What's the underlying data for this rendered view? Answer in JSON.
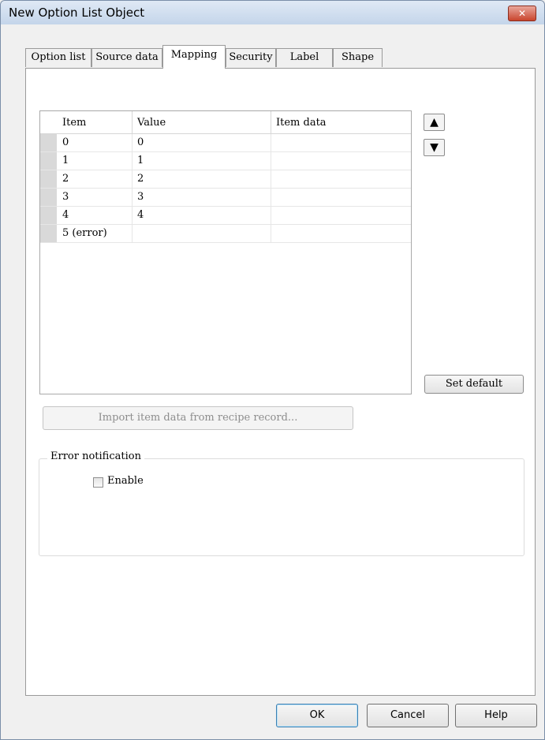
{
  "window": {
    "title": "New Option List Object",
    "close_glyph": "✕"
  },
  "tabs": [
    "Option list",
    "Source data",
    "Mapping",
    "Security",
    "Label",
    "Shape"
  ],
  "active_tab": "Mapping",
  "mapping_table": {
    "columns": [
      "Item",
      "Value",
      "Item data"
    ],
    "rows": [
      [
        "0",
        "0",
        ""
      ],
      [
        "1",
        "1",
        ""
      ],
      [
        "2",
        "2",
        ""
      ],
      [
        "3",
        "3",
        ""
      ],
      [
        "4",
        "4",
        ""
      ],
      [
        "5 (error)",
        "",
        ""
      ]
    ]
  },
  "controls": {
    "move_up_glyph": "▲",
    "move_down_glyph": "▼",
    "set_default_label": "Set default",
    "import_label": "Import item data from recipe record..."
  },
  "error_notification": {
    "label": "Error notification",
    "enable_label": "Enable",
    "enable_checked": false
  },
  "buttons": {
    "ok": "OK",
    "cancel": "Cancel",
    "help": "Help"
  }
}
